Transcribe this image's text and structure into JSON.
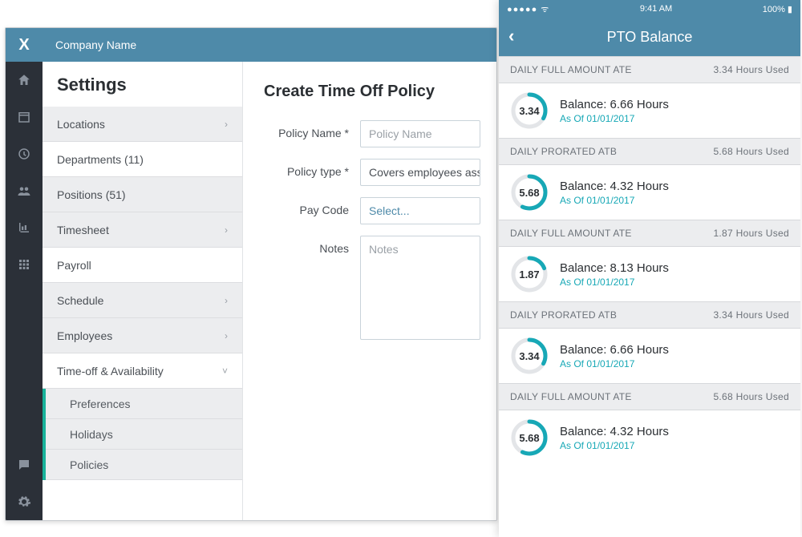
{
  "colors": {
    "brand": "#4e8aa9",
    "accent_ring": "#17a8b6",
    "sidebar_dark": "#2b3038",
    "sub_accent": "#18b29a"
  },
  "desktop": {
    "logo_text": "X",
    "header_title": "Company Name",
    "settings_heading": "Settings",
    "nav": [
      {
        "label": "Locations",
        "chevron": "›",
        "style": "gray"
      },
      {
        "label": "Departments (11)",
        "chevron": "",
        "style": "plain"
      },
      {
        "label": "Positions (51)",
        "chevron": "",
        "style": "gray"
      },
      {
        "label": "Timesheet",
        "chevron": "›",
        "style": "gray"
      },
      {
        "label": "Payroll",
        "chevron": "",
        "style": "plain"
      },
      {
        "label": "Schedule",
        "chevron": "›",
        "style": "gray"
      },
      {
        "label": "Employees",
        "chevron": "›",
        "style": "gray"
      },
      {
        "label": "Time-off & Availability",
        "chevron": "˅",
        "style": "plain",
        "expanded": true
      }
    ],
    "subnav": [
      {
        "label": "Preferences"
      },
      {
        "label": "Holidays"
      },
      {
        "label": "Policies"
      }
    ],
    "form": {
      "heading": "Create Time Off Policy",
      "policy_name_label": "Policy Name *",
      "policy_name_placeholder": "Policy Name",
      "policy_type_label": "Policy type *",
      "policy_type_value": "Covers employees ass",
      "pay_code_label": "Pay Code",
      "pay_code_value": "Select...",
      "notes_label": "Notes",
      "notes_placeholder": "Notes"
    }
  },
  "phone": {
    "status_time": "9:41 AM",
    "status_battery": "100%",
    "status_signal": "●●●●●",
    "title": "PTO Balance",
    "entries": [
      {
        "header_left": "DAILY FULL AMOUNT ATE",
        "header_right": "3.34 Hours Used",
        "ring": "3.34",
        "balance": "Balance: 6.66 Hours",
        "asof": "As Of 01/01/2017",
        "pct": 33
      },
      {
        "header_left": "DAILY PRORATED ATB",
        "header_right": "5.68 Hours Used",
        "ring": "5.68",
        "balance": "Balance: 4.32 Hours",
        "asof": "As Of 01/01/2017",
        "pct": 57
      },
      {
        "header_left": "DAILY FULL AMOUNT ATE",
        "header_right": "1.87 Hours Used",
        "ring": "1.87",
        "balance": "Balance: 8.13 Hours",
        "asof": "As Of 01/01/2017",
        "pct": 19
      },
      {
        "header_left": "DAILY PRORATED ATB",
        "header_right": "3.34 Hours Used",
        "ring": "3.34",
        "balance": "Balance: 6.66 Hours",
        "asof": "As Of 01/01/2017",
        "pct": 33
      },
      {
        "header_left": "DAILY FULL AMOUNT ATE",
        "header_right": "5.68 Hours Used",
        "ring": "5.68",
        "balance": "Balance: 4.32 Hours",
        "asof": "As Of 01/01/2017",
        "pct": 57
      }
    ]
  }
}
